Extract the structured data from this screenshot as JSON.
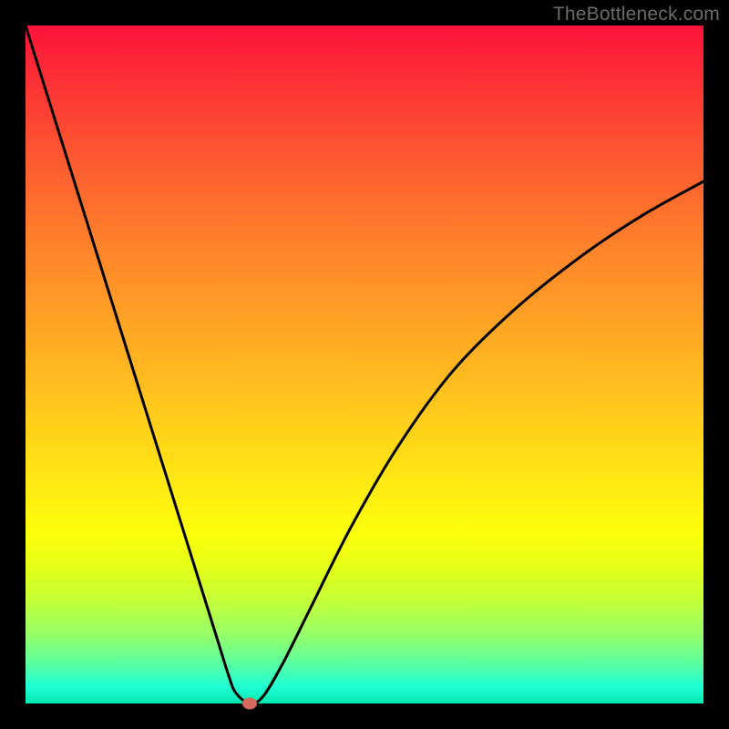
{
  "watermark": "TheBottleneck.com",
  "chart_data": {
    "type": "line",
    "title": "",
    "xlabel": "",
    "ylabel": "",
    "xlim": [
      0,
      100
    ],
    "ylim": [
      0,
      100
    ],
    "marker": {
      "x": 33,
      "y": 0
    },
    "series": [
      {
        "name": "curve",
        "x": [
          0,
          5,
          10,
          15,
          20,
          25,
          28,
          30,
          31,
          33,
          35,
          38,
          42,
          48,
          55,
          63,
          72,
          82,
          91,
          100
        ],
        "values": [
          100,
          84,
          68,
          52,
          36,
          20,
          10.4,
          4,
          1.6,
          0,
          1,
          6,
          14,
          26,
          38,
          49,
          58,
          66,
          72,
          77
        ]
      }
    ],
    "gradient_stops": [
      {
        "pos": 0,
        "color": "#fb1239"
      },
      {
        "pos": 8,
        "color": "#fc3036"
      },
      {
        "pos": 18,
        "color": "#fd5431"
      },
      {
        "pos": 30,
        "color": "#fe7a2c"
      },
      {
        "pos": 42,
        "color": "#ff9e26"
      },
      {
        "pos": 55,
        "color": "#ffc41e"
      },
      {
        "pos": 67,
        "color": "#ffe714"
      },
      {
        "pos": 75,
        "color": "#fbff0b"
      },
      {
        "pos": 80,
        "color": "#e4ff18"
      },
      {
        "pos": 85,
        "color": "#c3ff3a"
      },
      {
        "pos": 90,
        "color": "#94ff6a"
      },
      {
        "pos": 94,
        "color": "#5cffa0"
      },
      {
        "pos": 97.5,
        "color": "#21ffd4"
      },
      {
        "pos": 100,
        "color": "#05e6b0"
      }
    ]
  }
}
